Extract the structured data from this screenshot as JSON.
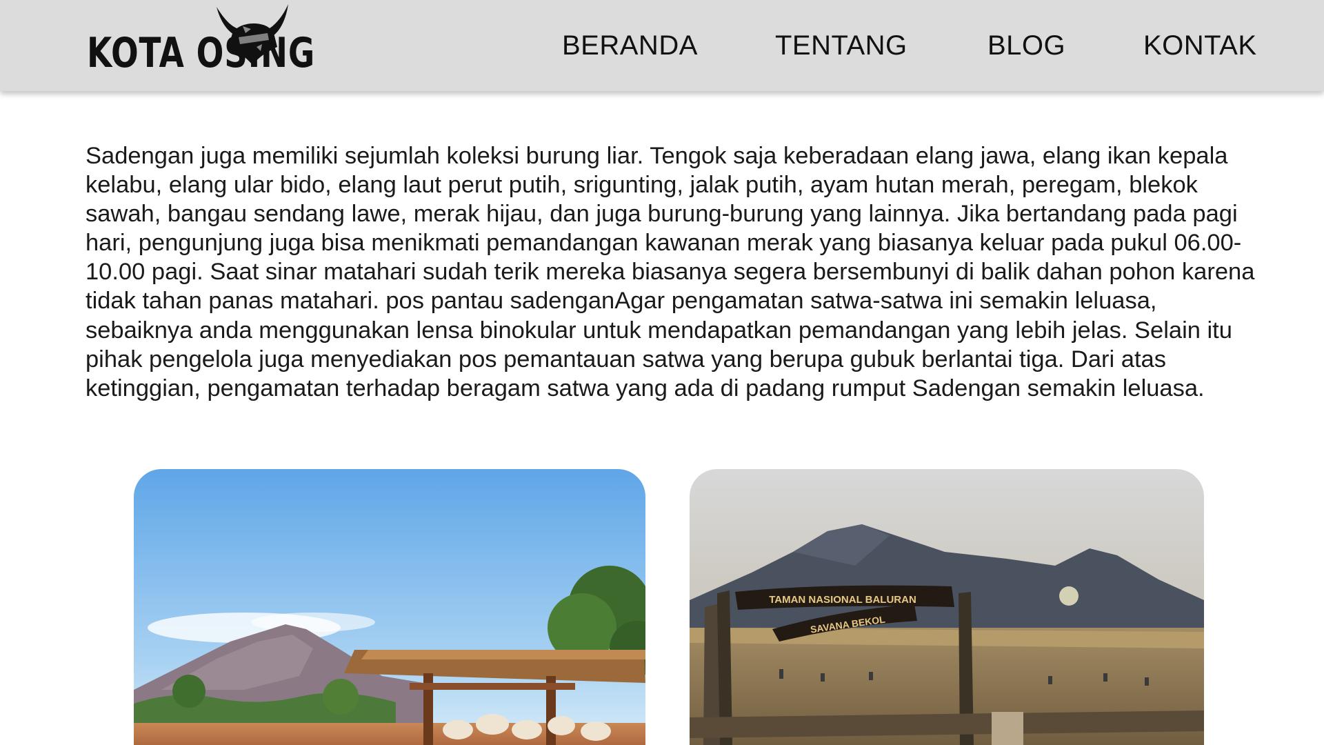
{
  "header": {
    "logo_text": "KOTA OSING",
    "logo_mark_icon": "horned-helmet-icon",
    "nav": [
      "BERANDA",
      "TENTANG",
      "BLOG",
      "KONTAK"
    ]
  },
  "article": {
    "body": "Sadengan juga memiliki sejumlah koleksi burung liar. Tengok saja keberadaan elang jawa, elang ikan kepala kelabu, elang ular bido, elang laut perut putih, srigunting, jalak putih, ayam hutan merah, peregam, blekok sawah, bangau sendang lawe, merak hijau, dan juga burung-burung yang lainnya. Jika bertandang pada pagi hari, pengunjung juga bisa menikmati pemandangan kawanan merak yang biasanya keluar pada pukul 06.00-10.00 pagi. Saat sinar matahari sudah terik mereka biasanya segera bersembunyi di balik dahan pohon karena tidak tahan panas matahari. pos pantau sadenganAgar pengamatan satwa-satwa ini semakin leluasa, sebaiknya anda menggunakan lensa binokular untuk mendapatkan pemandangan yang lebih jelas. Selain itu pihak pengelola juga menyediakan pos pemantauan satwa yang berupa gubuk berlantai tiga. Dari atas ketinggian, pengamatan terhadap beragam satwa yang ada di padang rumput Sadengan semakin leluasa."
  },
  "photos": {
    "photo_1": {
      "subject": "savanna-hut-with-skulls"
    },
    "photo_2": {
      "sign_top": "TAMAN NASIONAL BALURAN",
      "sign_bottom": "SAVANA BEKOL"
    }
  },
  "colors": {
    "navbar_bg": "#dcdcdc",
    "text": "#1a1a1a"
  }
}
